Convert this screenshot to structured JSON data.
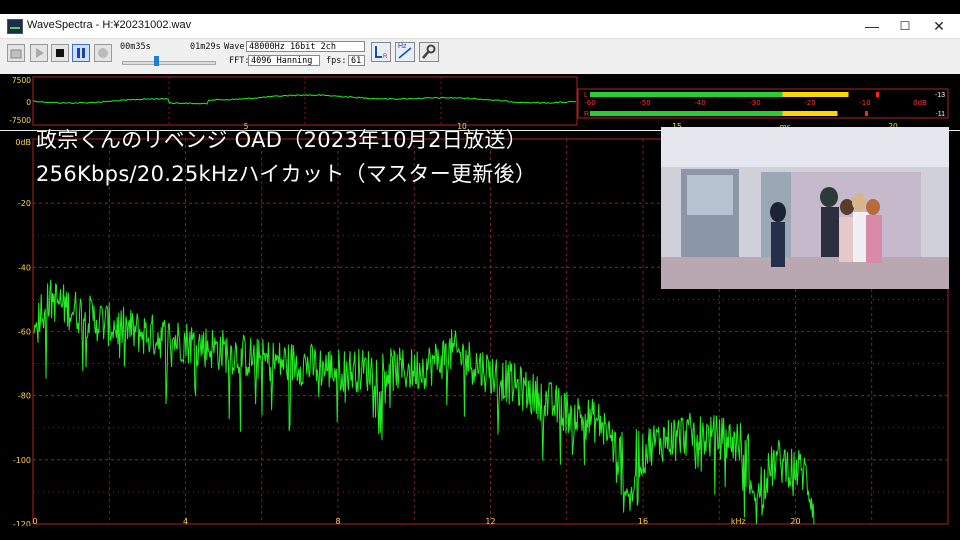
{
  "window": {
    "title": "WaveSpectra - H:¥20231002.wav",
    "minimize_glyph": "—",
    "maximize_glyph": "☐",
    "close_glyph": "✕"
  },
  "toolbar": {
    "time_elapsed": "00m35s",
    "time_total": "01m29s",
    "wave_label": "Wave:",
    "wave_value": "48000Hz 16bit 2ch",
    "fft_label": "FFT:",
    "fft_value": "4096 Hanning",
    "fps_label": "fps:",
    "fps_value": "61",
    "position_fraction": 0.37,
    "hz_icon_text": "Hz"
  },
  "waveform": {
    "y_ticks": [
      "7500",
      "0",
      "-7500"
    ],
    "x_ticks": [
      "5",
      "10",
      "15",
      "20"
    ],
    "x_unit": "ms"
  },
  "level_meter": {
    "ticks": [
      "-60",
      "-50",
      "-40",
      "-30",
      "-20",
      "-10",
      "0dB"
    ],
    "channels": [
      {
        "label": "L",
        "level_db": -13,
        "peak_db": -8,
        "readout": "-13"
      },
      {
        "label": "R",
        "level_db": -15,
        "peak_db": -10,
        "readout": "-11"
      }
    ]
  },
  "overlay": {
    "line1": "政宗くんのリベンジ OAD（2023年10月2日放送）",
    "line2": "256Kbps/20.25kHzハイカット（マスター更新後）"
  },
  "chart_data": {
    "type": "line",
    "title": "",
    "xlabel": "kHz",
    "ylabel": "",
    "xlim": [
      0,
      24
    ],
    "ylim": [
      -120,
      0
    ],
    "x_ticks": [
      "0",
      "4",
      "8",
      "12",
      "16",
      "20"
    ],
    "y_ticks": [
      "0dB",
      "-20",
      "-40",
      "-60",
      "-80",
      "-100",
      "-120"
    ],
    "grid": true,
    "series": [
      {
        "color": "#22ee22",
        "envelope": [
          [
            0,
            -55
          ],
          [
            0.5,
            -50
          ],
          [
            1,
            -53
          ],
          [
            2,
            -58
          ],
          [
            3,
            -61
          ],
          [
            4,
            -63
          ],
          [
            5,
            -66
          ],
          [
            6,
            -69
          ],
          [
            7,
            -70
          ],
          [
            8,
            -72
          ],
          [
            9,
            -72
          ],
          [
            10,
            -72
          ],
          [
            10.5,
            -70
          ],
          [
            11,
            -66
          ],
          [
            12,
            -73
          ],
          [
            13,
            -79
          ],
          [
            14,
            -85
          ],
          [
            15,
            -89
          ],
          [
            15.6,
            -106
          ],
          [
            16.2,
            -95
          ],
          [
            17,
            -92
          ],
          [
            18,
            -93
          ],
          [
            18.6,
            -95
          ],
          [
            19,
            -110
          ],
          [
            19.5,
            -100
          ],
          [
            20.25,
            -104
          ],
          [
            20.6,
            -120
          ]
        ]
      }
    ]
  },
  "colors": {
    "spectrum_line": "#22ee22",
    "grid": "#b02020",
    "axis_labels": "#ffd24a",
    "meter_green": "#2ecc2e",
    "meter_yellow": "#ffd400",
    "meter_red": "#ff2020"
  }
}
